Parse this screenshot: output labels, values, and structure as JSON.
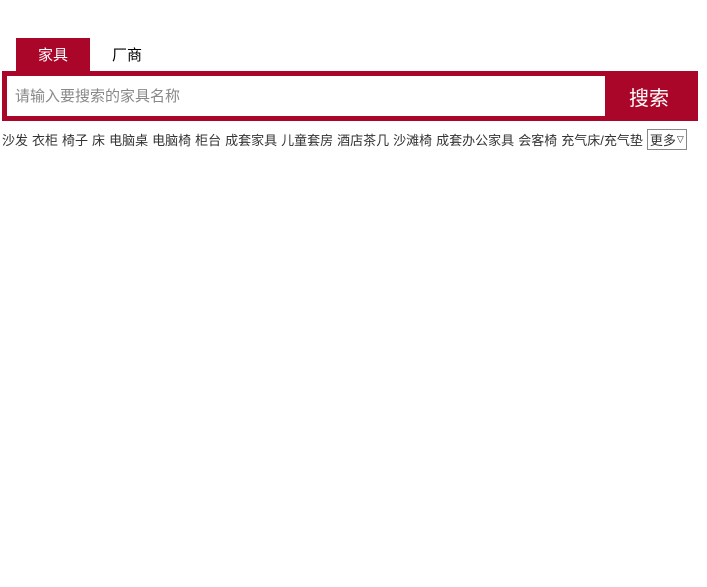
{
  "tabs": [
    {
      "label": "家具",
      "active": true
    },
    {
      "label": "厂商",
      "active": false
    }
  ],
  "search": {
    "placeholder": "请输入要搜索的家具名称",
    "button_label": "搜索"
  },
  "hot_links": [
    "沙发",
    "衣柜",
    "椅子",
    "床",
    "电脑桌",
    "电脑椅",
    "柜台",
    "成套家具",
    "儿童套房",
    "酒店茶几",
    "沙滩椅",
    "成套办公家具",
    "会客椅",
    "充气床/充气垫"
  ],
  "more_label": "更多"
}
